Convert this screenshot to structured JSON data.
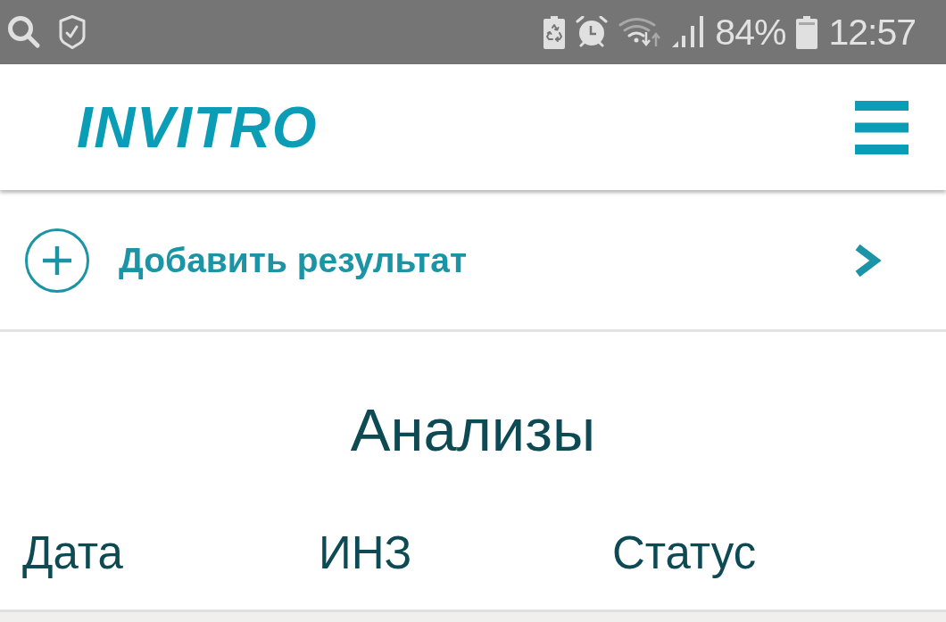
{
  "status_bar": {
    "battery_percent": "84%",
    "time": "12:57"
  },
  "header": {
    "logo": "INVITRO"
  },
  "add_result": {
    "label": "Добавить результат"
  },
  "section_title": "Анализы",
  "table": {
    "columns": [
      "Дата",
      "ИНЗ",
      "Статус"
    ]
  }
}
